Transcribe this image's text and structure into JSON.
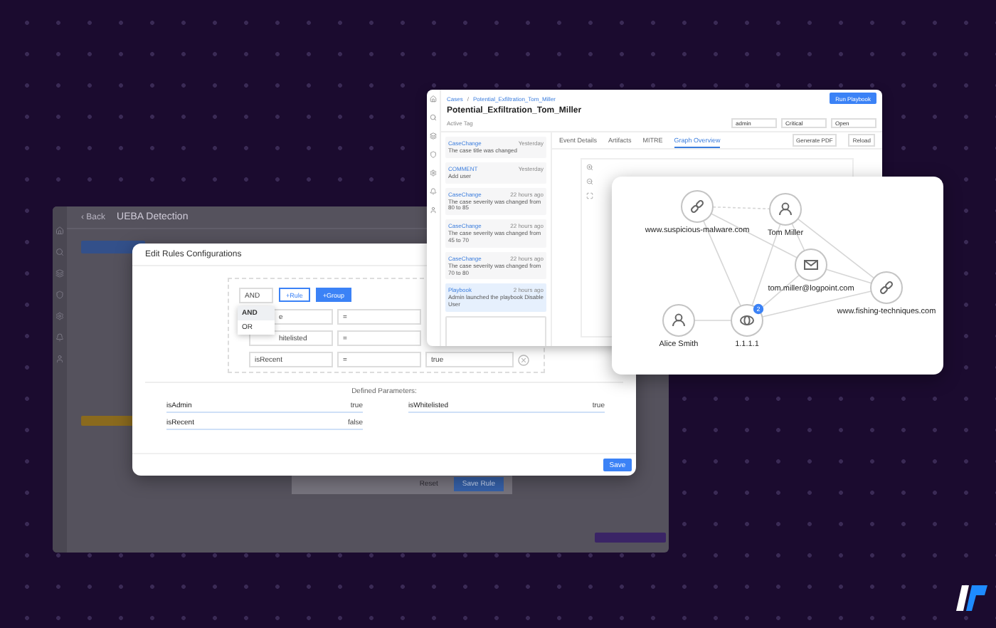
{
  "background_window": {
    "back": "‹ Back",
    "title": "UEBA Detection",
    "footer_buttons": [
      {
        "label": "Reset",
        "primary": false
      },
      {
        "label": "Save Rule",
        "primary": true
      }
    ]
  },
  "case_window": {
    "breadcrumb": [
      "Cases",
      "Potential_Exfiltration_Tom_Miller"
    ],
    "breadcrumb_separator": "/",
    "title": "Potential_Exfiltration_Tom_Miller",
    "tag": "Active Tag",
    "filters": [
      "admin",
      "Critical",
      "Open"
    ],
    "primary_action": "Run Playbook",
    "activity": [
      {
        "kind": "CaseChange",
        "time": "Yesterday",
        "text": "The case title was changed",
        "selected": false
      },
      {
        "kind": "COMMENT",
        "time": "Yesterday",
        "text": "Add user",
        "selected": false
      },
      {
        "kind": "CaseChange",
        "time": "22 hours ago",
        "text": "The case severity was changed from 80 to 85",
        "selected": false
      },
      {
        "kind": "CaseChange",
        "time": "22 hours ago",
        "text": "The case severity was changed from 45 to 70",
        "selected": false
      },
      {
        "kind": "CaseChange",
        "time": "22 hours ago",
        "text": "The case severity was changed from 70 to 80",
        "selected": false
      },
      {
        "kind": "Playbook",
        "time": "2 hours ago",
        "text": "Admin launched the playbook Disable User",
        "selected": true
      }
    ],
    "tabs": [
      {
        "label": "Event Details",
        "selected": false
      },
      {
        "label": "Artifacts",
        "selected": false
      },
      {
        "label": "MITRE",
        "selected": false
      },
      {
        "label": "Graph Overview",
        "selected": true
      }
    ],
    "actions": [
      "Generate PDF",
      "Reload"
    ]
  },
  "rules_dialog": {
    "title": "Edit Rules Configurations",
    "combinator": "AND",
    "add_rule": "+Rule",
    "add_group": "+Group",
    "combinator_options": [
      {
        "label": "AND",
        "selected": true
      },
      {
        "label": "OR",
        "selected": false
      }
    ],
    "rules": [
      {
        "field": "e",
        "operator": "="
      },
      {
        "field": "hitelisted",
        "operator": "="
      },
      {
        "field": "isRecent",
        "operator": "=",
        "value": "true"
      }
    ],
    "parameters_title": "Defined Parameters:",
    "parameters": [
      {
        "name": "isAdmin",
        "value": "true"
      },
      {
        "name": "isWhitelisted",
        "value": "true"
      },
      {
        "name": "isRecent",
        "value": "false"
      }
    ],
    "save": "Save"
  },
  "graph": {
    "nodes": [
      {
        "label": "www.suspicious-malware.com",
        "kind": "link"
      },
      {
        "label": "Tom Miller",
        "kind": "person"
      },
      {
        "label": "tom.miller@logpoint.com",
        "kind": "email"
      },
      {
        "label": "www.fishing-techniques.com",
        "kind": "link"
      },
      {
        "label": "Alice Smith",
        "kind": "person"
      },
      {
        "label": "1.1.1.1",
        "kind": "ip",
        "badge": "2"
      }
    ]
  }
}
